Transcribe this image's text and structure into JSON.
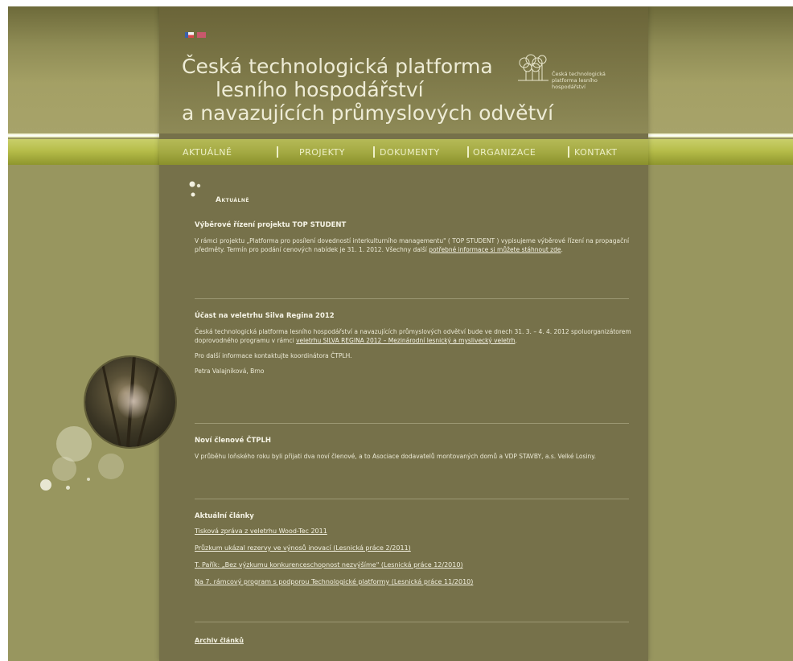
{
  "header": {
    "title_line1": "Česká technologická platforma",
    "title_line2": "lesního hospodářství",
    "title_line3": "a navazujících průmyslových odvětví",
    "logo_text_line1": "Česká technologická",
    "logo_text_line2": "platforma lesního",
    "logo_text_line3": "hospodářství",
    "languages": [
      "cs-flag-icon",
      "en-flag-icon"
    ]
  },
  "menu": {
    "items": [
      "AKTUÁLNĚ",
      "PROJEKTY",
      "DOKUMENTY",
      "ORGANIZACE",
      "KONTAKT"
    ]
  },
  "main": {
    "section_title": "Aktuálně",
    "news": [
      {
        "title": "Výběrové řízení projektu TOP STUDENT",
        "text": "V rámci projektu „Platforma pro posílení dovedností interkulturního managementu\" ( TOP STUDENT ) vypisujeme výběrové řízení na propagační předměty. Termín pro podání cenových nabídek je 31. 1. 2012. Všechny další",
        "link": "potřebné informace si můžete stáhnout zde",
        "text_end": "."
      },
      {
        "title": "Účast na veletrhu Silva Regina 2012",
        "text": "Česká technologická platforma lesního hospodářství a navazujících průmyslových odvětví bude ve dnech 31. 3. – 4. 4. 2012 spoluorganizátorem doprovodného programu v rámci",
        "link": "veletrhu SILVA REGINA 2012 – Mezinárodní lesnický a myslivecký veletrh",
        "text_end": ".",
        "text2": "Pro další informace kontaktujte koordinátora ČTPLH.",
        "text3": "Petra Valajníková, Brno"
      },
      {
        "title": "Noví členové ČTPLH",
        "text": "V průběhu loňského roku byli přijati dva noví členové, a to Asociace dodavatelů montovaných domů a VDP STAVBY, a.s. Velké Losiny."
      }
    ],
    "articles_title": "Aktuální články",
    "articles": [
      "Tisková zpráva z veletrhu Wood-Tec 2011",
      "Průzkum ukázal rezervy ve výnosů inovací (Lesnická práce 2/2011)",
      "T. Pařík: „Bez výzkumu konkurenceschopnost nezvýšíme\" (Lesnická práce 12/2010)",
      "Na 7. rámcový program s podporou Technologické platformy (Lesnická práce 11/2010)"
    ],
    "archive_link": "Archiv článků"
  },
  "colors": {
    "page_bg": "#98965f",
    "column_bg": "#76714a",
    "menu_band": "#b6bd4a",
    "text": "#f1efdc"
  }
}
